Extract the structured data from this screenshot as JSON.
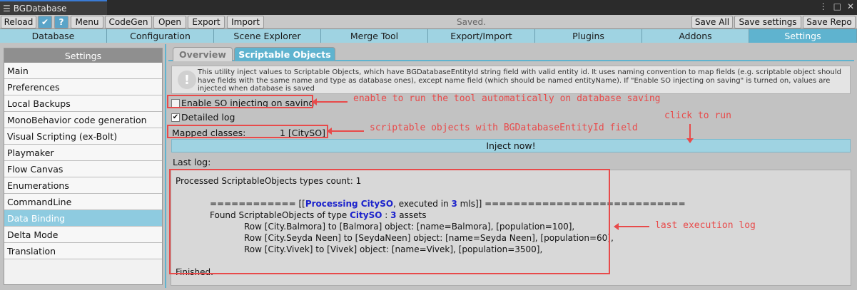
{
  "window": {
    "title": "BGDatabase"
  },
  "toolbar": {
    "reload": "Reload",
    "menu": "Menu",
    "codegen": "CodeGen",
    "open": "Open",
    "export": "Export",
    "import": "Import",
    "status": "Saved.",
    "save_all": "Save All",
    "save_settings": "Save settings",
    "save_repo": "Save Repo"
  },
  "main_tabs": [
    "Database",
    "Configuration",
    "Scene Explorer",
    "Merge Tool",
    "Export/Import",
    "Plugins",
    "Addons",
    "Settings"
  ],
  "sidebar": {
    "header": "Settings",
    "items": [
      "Main",
      "Preferences",
      "Local Backups",
      "MonoBehavior code generation",
      "Visual Scripting (ex-Bolt)",
      "Playmaker",
      "Flow Canvas",
      "Enumerations",
      "CommandLine",
      "Data Binding",
      "Delta Mode",
      "Translation"
    ]
  },
  "sub_tabs": [
    "Overview",
    "Scriptable Objects"
  ],
  "info_text": "This utility inject values to Scriptable Objects, which have BGDatabaseEntityId string field with valid entity id. It uses naming convention to map fields (e.g. scriptable object should have fields with the same name and type as database ones), except name field (which should be named entityName). If \"Enable SO injecting on saving\" is turned on, values are injected when database is saved",
  "options": {
    "enable_so": "Enable SO injecting on saving",
    "detailed_log": "Detailed log",
    "mapped_label": "Mapped classes:",
    "mapped_value": "1 [CitySO]",
    "inject_button": "Inject now!",
    "last_log_label": "Last log:"
  },
  "log": {
    "line1": "Processed ScriptableObjects types count: 1",
    "proc_prefix": "============ [[",
    "proc_name": "Processing CitySO",
    "proc_mid": ", executed in ",
    "proc_ms": "3",
    "proc_suffix": " mls]] ============================",
    "found_prefix": "Found ScriptableObjects of type ",
    "found_type": "CitySO",
    "found_sep": " : ",
    "found_count": "3",
    "found_suffix": " assets",
    "rows": [
      "Row [City.Balmora] to [Balmora] object: [name=Balmora], [population=100],",
      "Row [City.Seyda Neen] to [SeydaNeen] object: [name=Seyda Neen], [population=60],",
      "Row [City.Vivek] to [Vivek] object: [name=Vivek], [population=3500],"
    ],
    "finished": "Finished."
  },
  "annotations": {
    "enable_note": "enable to run the tool automatically on database saving",
    "mapped_note": "scriptable objects with BGDatabaseEntityId field",
    "click_note": "click to run",
    "log_note": "last execution log"
  }
}
